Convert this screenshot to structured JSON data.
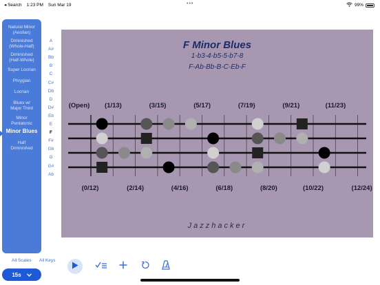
{
  "status_bar": {
    "back_label": "◂ Search",
    "time": "1:23 PM",
    "date": "Sun Mar 19",
    "battery": "99%"
  },
  "scales": [
    {
      "label": "Natural Minor",
      "label2": "(Aeolian)",
      "selected": false
    },
    {
      "label": "Diminished",
      "label2": "(Whole-Half)",
      "selected": false
    },
    {
      "label": "Diminished",
      "label2": "(Half-Whole)",
      "selected": false
    },
    {
      "label": "Super Locrian",
      "label2": "",
      "selected": false
    },
    {
      "label": "Phrygian",
      "label2": "",
      "selected": false
    },
    {
      "label": "Locrian",
      "label2": "",
      "selected": false
    },
    {
      "label": "Blues w/",
      "label2": "Major Third",
      "selected": false
    },
    {
      "label": "Minor",
      "label2": "Pentatonic",
      "selected": false
    },
    {
      "label": "Minor Blues",
      "label2": "",
      "selected": true
    },
    {
      "label": "Half",
      "label2": "Diminished",
      "selected": false
    }
  ],
  "keys": [
    "A",
    "A#",
    "Bb",
    "B",
    "C",
    "C#",
    "Db",
    "D",
    "D#",
    "Eb",
    "E",
    "F",
    "F#",
    "Gb",
    "G",
    "G#",
    "Ab"
  ],
  "selected_key": "F",
  "board": {
    "title": "F Minor Blues",
    "formula": "1-b3-4-b5-5-b7-8",
    "notes": "F-Ab-Bb-B-C-Eb-F",
    "brand": "Jazzhacker",
    "top_labels": [
      "(Open)",
      "(1/13)",
      "(3/15)",
      "(5/17)",
      "(7/19)",
      "(9/21)",
      "(11/23)"
    ],
    "bottom_labels": [
      "(0/12)",
      "(2/14)",
      "(4/16)",
      "(6/18)",
      "(8/20)",
      "(10/22)",
      "(12/24)"
    ],
    "fret_count": 12,
    "markers": [
      {
        "string": 1,
        "fret": 1,
        "shape": "circle",
        "color": "#000000"
      },
      {
        "string": 1,
        "fret": 3,
        "shape": "circle",
        "color": "#555555"
      },
      {
        "string": 1,
        "fret": 4,
        "shape": "circle",
        "color": "#8a8a8a"
      },
      {
        "string": 1,
        "fret": 5,
        "shape": "circle",
        "color": "#b0b0b0"
      },
      {
        "string": 1,
        "fret": 8,
        "shape": "circle",
        "color": "#d0d0d0"
      },
      {
        "string": 1,
        "fret": 10,
        "shape": "square",
        "color": "#222222"
      },
      {
        "string": 2,
        "fret": 1,
        "shape": "circle",
        "color": "#d0d0d0"
      },
      {
        "string": 2,
        "fret": 3,
        "shape": "square",
        "color": "#222222"
      },
      {
        "string": 2,
        "fret": 6,
        "shape": "circle",
        "color": "#000000"
      },
      {
        "string": 2,
        "fret": 8,
        "shape": "circle",
        "color": "#555555"
      },
      {
        "string": 2,
        "fret": 9,
        "shape": "circle",
        "color": "#8a8a8a"
      },
      {
        "string": 2,
        "fret": 10,
        "shape": "circle",
        "color": "#b0b0b0"
      },
      {
        "string": 3,
        "fret": 1,
        "shape": "circle",
        "color": "#555555"
      },
      {
        "string": 3,
        "fret": 2,
        "shape": "circle",
        "color": "#8a8a8a"
      },
      {
        "string": 3,
        "fret": 3,
        "shape": "circle",
        "color": "#b0b0b0"
      },
      {
        "string": 3,
        "fret": 6,
        "shape": "circle",
        "color": "#d0d0d0"
      },
      {
        "string": 3,
        "fret": 8,
        "shape": "square",
        "color": "#222222"
      },
      {
        "string": 3,
        "fret": 11,
        "shape": "circle",
        "color": "#000000"
      },
      {
        "string": 4,
        "fret": 1,
        "shape": "square",
        "color": "#222222"
      },
      {
        "string": 4,
        "fret": 4,
        "shape": "circle",
        "color": "#000000"
      },
      {
        "string": 4,
        "fret": 6,
        "shape": "circle",
        "color": "#555555"
      },
      {
        "string": 4,
        "fret": 7,
        "shape": "circle",
        "color": "#8a8a8a"
      },
      {
        "string": 4,
        "fret": 8,
        "shape": "circle",
        "color": "#b0b0b0"
      },
      {
        "string": 4,
        "fret": 11,
        "shape": "circle",
        "color": "#d0d0d0"
      }
    ]
  },
  "bottom": {
    "all_scales": "All Scales",
    "all_keys": "All Keys",
    "tempo": "15s"
  },
  "toolbar_icons": [
    "play-icon",
    "checklist-icon",
    "plus-icon",
    "repeat-icon",
    "metronome-icon"
  ],
  "colors": {
    "accent": "#4a7bd8",
    "board_bg": "#a897b1",
    "title": "#1d2c68"
  }
}
